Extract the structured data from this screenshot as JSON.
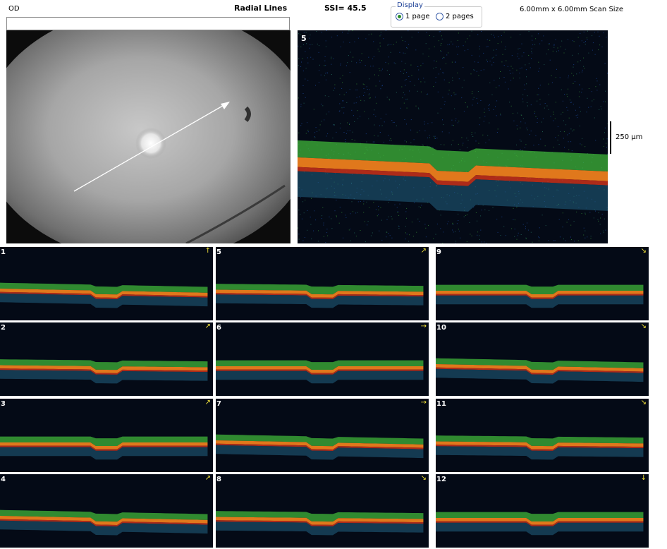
{
  "header": {
    "eye": "OD",
    "scan_type": "Radial Lines",
    "ssi": "SSI= 45.5",
    "scan_size": "6.00mm x 6.00mm Scan Size"
  },
  "display": {
    "legend": "Display",
    "options": [
      {
        "label": "1 page",
        "selected": true
      },
      {
        "label": "2 pages",
        "selected": false
      }
    ]
  },
  "main_scan": {
    "number": "5",
    "scale_label": "250 µm"
  },
  "tiles": [
    {
      "number": "1",
      "arrow": "north"
    },
    {
      "number": "2",
      "arrow": "north-east"
    },
    {
      "number": "3",
      "arrow": "north-east"
    },
    {
      "number": "4",
      "arrow": "north-east"
    },
    {
      "number": "5",
      "arrow": "east-north-east"
    },
    {
      "number": "6",
      "arrow": "east"
    },
    {
      "number": "7",
      "arrow": "east"
    },
    {
      "number": "8",
      "arrow": "south-east"
    },
    {
      "number": "9",
      "arrow": "south-east"
    },
    {
      "number": "10",
      "arrow": "south-east"
    },
    {
      "number": "11",
      "arrow": "south-east"
    },
    {
      "number": "12",
      "arrow": "south"
    }
  ],
  "colors": {
    "oct_background": "#040a16",
    "retina_green": "#3fb53a",
    "rpe_orange": "#e0781c",
    "rpe_red": "#d8331a",
    "fundus_gray": "#9a9a9a"
  }
}
